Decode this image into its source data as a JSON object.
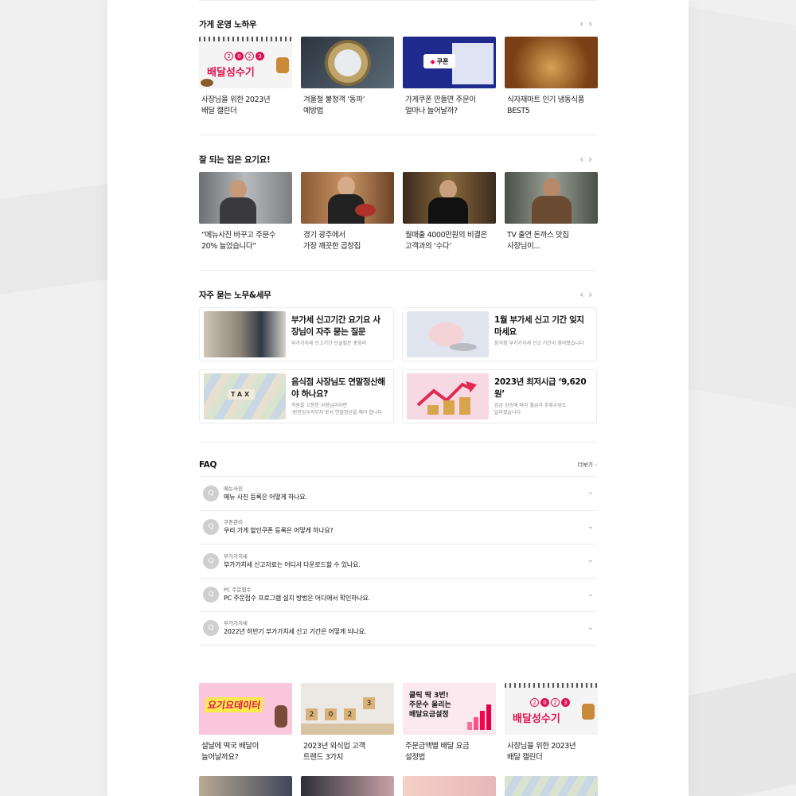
{
  "sections": {
    "know_how": {
      "title": "가게 운영 노하우",
      "cards": [
        {
          "caption": "사장님을 위한 2023년\n배달 캘린더",
          "art": "calendar",
          "art_text": "배달성수기",
          "art_year": [
            "2",
            "0",
            "2",
            "3"
          ]
        },
        {
          "caption": "겨울철 불청객 ‘동파’\n예방법",
          "art": "meter"
        },
        {
          "caption": "가게쿠폰 만들면 주문이\n얼마나 늘어날까?",
          "art": "coupon",
          "art_text": "쿠폰"
        },
        {
          "caption": "식자재마트 인기 냉동식품\nBEST5",
          "art": "food"
        }
      ]
    },
    "stories": {
      "title": "잘 되는 집은 요기요!",
      "cards": [
        {
          "caption": "“메뉴사진 바꾸고 주문수\n20% 늘었습니다”",
          "art": "person1"
        },
        {
          "caption": "경기 광주에서\n가장 깨끗한 곱창집",
          "art": "person2"
        },
        {
          "caption": "월매출 4000만원의 비결은\n고객과의 ‘수다’",
          "art": "person3"
        },
        {
          "caption": "TV 출연 돈까스 맛집\n사장님이...",
          "art": "person4"
        }
      ]
    },
    "tax": {
      "title": "자주 묻는 노무&세무",
      "tiles": [
        {
          "title": "부가세 신고기간 요기요 사\n장님이 자주 묻는 질문",
          "sub": "부가가치세 신고기간 단골질문 총정리",
          "art": "register"
        },
        {
          "title": "1월 부가세 신고 기간 잊지\n마세요",
          "sub": "음식점 부가가치세 신고 기간이 찾아왔습니다",
          "art": "piggy"
        },
        {
          "title": "음식점 사장님도 연말정산해\n야 하나요?",
          "sub": "직원을 고용한 사장님이라면\n'원천징수의무자'로서 연말정산을 해야 합니다",
          "art": "taxmoney",
          "art_text": "TAX"
        },
        {
          "title": "2023년 최저시급 ‘9,620원’",
          "sub": "임금 상승에 따라 월급과 주휴수당도\n달라졌습니다",
          "art": "coins"
        }
      ]
    },
    "faq": {
      "title": "FAQ",
      "more": "더보기",
      "items": [
        {
          "badge": "Q",
          "category": "메뉴사진",
          "question": "메뉴 사진 등록은 어떻게 하나요."
        },
        {
          "badge": "Q",
          "category": "쿠폰관리",
          "question": "우리 가게 할인쿠폰 등록은 어떻게 하나요?"
        },
        {
          "badge": "Q",
          "category": "부가가치세",
          "question": "부가가치세 신고자료는 어디서 다운로드할 수 있나요."
        },
        {
          "badge": "Q",
          "category": "PC 주문접수",
          "question": "PC 주문접수 프로그램 설치 방법은 어디에서 확인하나요."
        },
        {
          "badge": "Q",
          "category": "부가가치세",
          "question": "2022년 하반기 부가가치세 신고 기간은 어떻게 되나요."
        }
      ]
    },
    "bottom": {
      "cards": [
        {
          "caption": "설날에 떡국 배달이\n늘어날까요?",
          "art": "yogiyodata",
          "art_text": "요기요데이터"
        },
        {
          "caption": "2023년 외식업 고객\n트렌드 3가지",
          "art": "blocks",
          "art_year": [
            "2",
            "0",
            "2",
            "3"
          ]
        },
        {
          "caption": "주문금액별 배달 요금\n설정법",
          "art": "clickfee",
          "art_text": "클릭 딱 3번!\n주문수 올리는\n배달요금설정"
        },
        {
          "caption": "사장님을 위한 2023년\n배달 캘린더",
          "art": "calendar",
          "art_text": "배달성수기",
          "art_year": [
            "2",
            "0",
            "2",
            "3"
          ]
        }
      ]
    }
  },
  "colors": {
    "accent": "#fa0050",
    "text": "#111111",
    "muted": "#888888",
    "divider": "#ececec"
  },
  "icons": {
    "prev": "‹",
    "next": "›",
    "chevron_down": "⌄",
    "more_arrow": "›"
  }
}
